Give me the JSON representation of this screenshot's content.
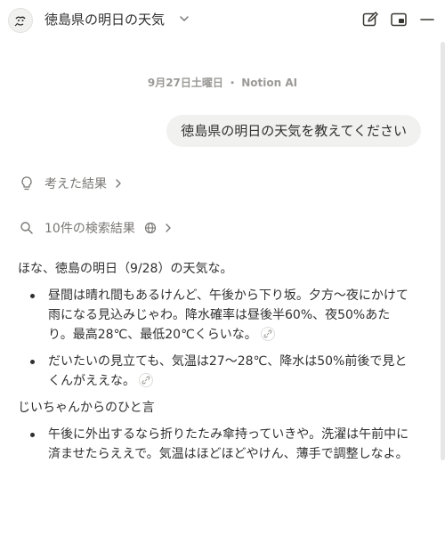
{
  "header": {
    "title": "徳島県の明日の天気"
  },
  "chat": {
    "meta": "9月27日土曜日 ・ Notion AI",
    "user_message": "徳島県の明日の天気を教えてください",
    "thinking_label": "考えた結果",
    "search_label": "10件の検索結果",
    "answer": {
      "intro": "ほな、徳島の明日（9/28）の天気な。",
      "bullets1": [
        "昼間は晴れ間もあるけんど、午後から下り坂。夕方～夜にかけて雨になる見込みじゃわ。降水確率は昼後半60%、夜50%あたり。最高28℃、最低20℃くらいな。",
        "だいたいの見立ても、気温は27～28℃、降水は50%前後で見とくんがええな。"
      ],
      "section_title": "じいちゃんからのひと言",
      "bullets2": [
        "午後に外出するなら折りたたみ傘持っていきや。洗濯は午前中に済ませたらええで。気温はほどほどやけん、薄手で調整しなよ。"
      ]
    }
  }
}
